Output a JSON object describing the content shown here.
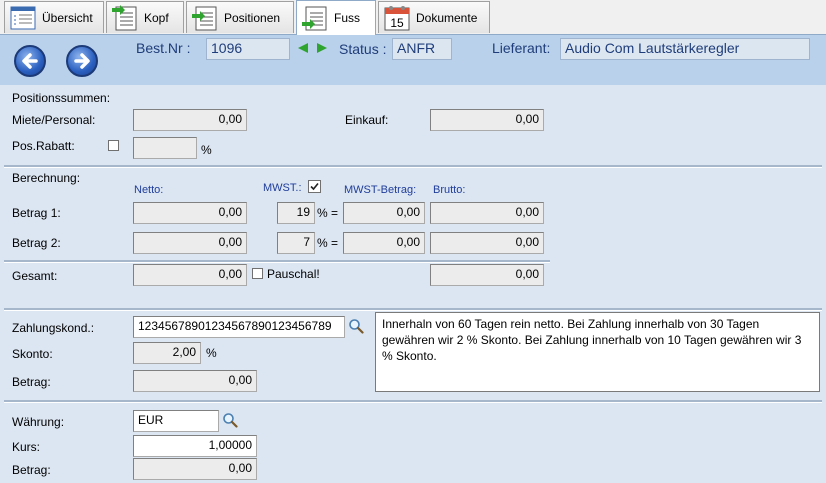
{
  "tabs": [
    {
      "label": "Übersicht",
      "icon": "overview-icon"
    },
    {
      "label": "Kopf",
      "icon": "head-icon"
    },
    {
      "label": "Positionen",
      "icon": "positions-icon"
    },
    {
      "label": "Fuss",
      "icon": "footer-icon",
      "active": true
    },
    {
      "label": "Dokumente",
      "icon": "calendar-icon",
      "calendar_day": "15"
    }
  ],
  "header": {
    "order_no_label": "Best.Nr :",
    "order_no": "1096",
    "status_label": "Status :",
    "status": "ANFR",
    "supplier_label": "Lieferant:",
    "supplier": "Audio Com Lautstärkeregler"
  },
  "positions": {
    "title": "Positionssummen:",
    "rent_label": "Miete/Personal:",
    "rent_value": "0,00",
    "purchase_label": "Einkauf:",
    "purchase_value": "0,00",
    "discount_label": "Pos.Rabatt:",
    "discount_value": "",
    "percent": "%"
  },
  "calc": {
    "title": "Berechnung:",
    "col_net": "Netto:",
    "col_vat": "MWST.:",
    "col_vat_amount": "MWST-Betrag:",
    "col_gross": "Brutto:",
    "rows": [
      {
        "label": "Betrag 1:",
        "net": "0,00",
        "rate": "19",
        "pct_eq": "% =",
        "vat": "0,00",
        "gross": "0,00"
      },
      {
        "label": "Betrag 2:",
        "net": "0,00",
        "rate": "7",
        "pct_eq": "% =",
        "vat": "0,00",
        "gross": "0,00"
      }
    ],
    "total_label": "Gesamt:",
    "total_net": "0,00",
    "flat_label": "Pauschal!",
    "total_gross": "0,00"
  },
  "payment": {
    "terms_label": "Zahlungskond.:",
    "terms_value": "12345678901234567890123456789",
    "discount_label": "Skonto:",
    "discount_value": "2,00",
    "percent": "%",
    "amount_label": "Betrag:",
    "amount_value": "0,00",
    "terms_text": "Innerhaln von 60 Tagen rein netto. Bei Zahlung innerhalb von 30 Tagen gewähren wir 2 % Skonto. Bei Zahlung innerhalb von 10 Tagen gewähren wir 3 % Skonto."
  },
  "currency": {
    "currency_label": "Währung:",
    "currency_value": "EUR",
    "rate_label": "Kurs:",
    "rate_value": "1,00000",
    "amount_label": "Betrag:",
    "amount_value": "0,00"
  },
  "colors": {
    "background": "#b9d1ea",
    "panel": "#dce6f3",
    "label_blue": "#1f3d7a",
    "arrow_green": "#2fa52f"
  }
}
